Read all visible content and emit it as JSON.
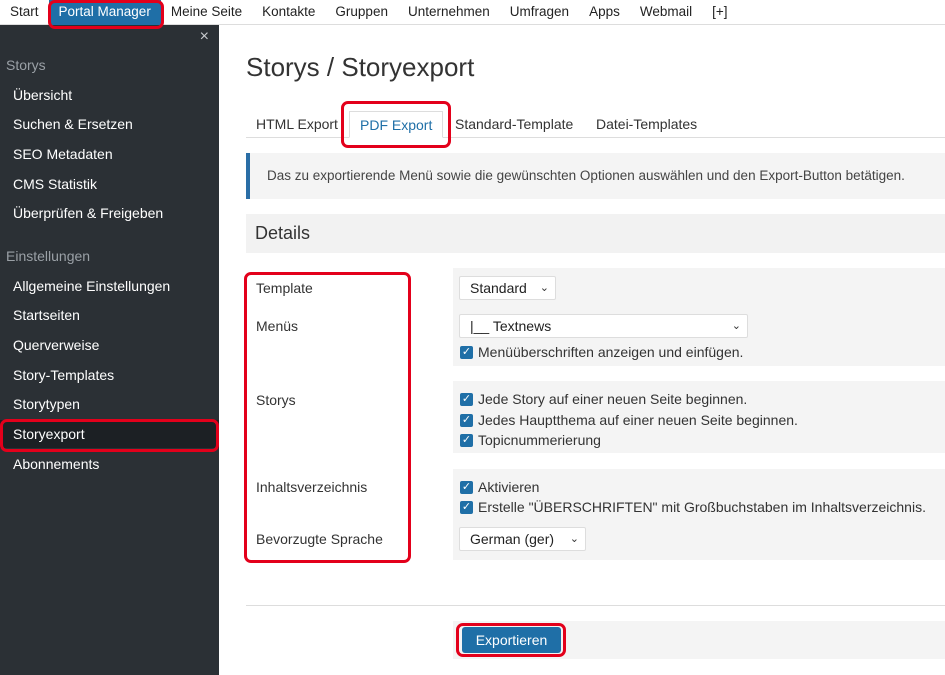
{
  "topnav": {
    "items": [
      "Start",
      "Portal Manager",
      "Meine Seite",
      "Kontakte",
      "Gruppen",
      "Unternehmen",
      "Umfragen",
      "Apps",
      "Webmail",
      "[+]"
    ]
  },
  "sidebar": {
    "close": "×",
    "section1": "Storys",
    "items1": [
      "Übersicht",
      "Suchen & Ersetzen",
      "SEO Metadaten",
      "CMS Statistik",
      "Überprüfen & Freigeben"
    ],
    "section2": "Einstellungen",
    "items2": [
      "Allgemeine Einstellungen",
      "Startseiten",
      "Querverweise",
      "Story-Templates",
      "Storytypen",
      "Storyexport",
      "Abonnements"
    ]
  },
  "main": {
    "title": "Storys / Storyexport",
    "tabs": [
      "HTML Export",
      "PDF Export",
      "Standard-Template",
      "Datei-Templates"
    ],
    "info": "Das zu exportierende Menü sowie die gewünschten Optionen auswählen und den Export-Button betätigen.",
    "details": "Details",
    "labels": {
      "template": "Template",
      "menus": "Menüs",
      "storys": "Storys",
      "toc": "Inhaltsverzeichnis",
      "language": "Bevorzugte Sprache"
    },
    "template_select": "Standard",
    "menu_select": "|__ Textnews",
    "menu_checks": [
      "Menüüberschriften anzeigen und einfügen."
    ],
    "story_checks": [
      "Jede Story auf einer neuen Seite beginnen.",
      "Jedes Hauptthema auf einer neuen Seite beginnen.",
      "Topicnummerierung"
    ],
    "toc_checks": [
      "Aktivieren",
      "Erstelle \"ÜBERSCHRIFTEN\" mit Großbuchstaben im Inhaltsverzeichnis."
    ],
    "language_select": "German (ger)",
    "export_button": "Exportieren"
  },
  "colors": {
    "accent": "#1f6fa7",
    "sidebar": "#2b3035",
    "highlight": "#e3001b"
  }
}
